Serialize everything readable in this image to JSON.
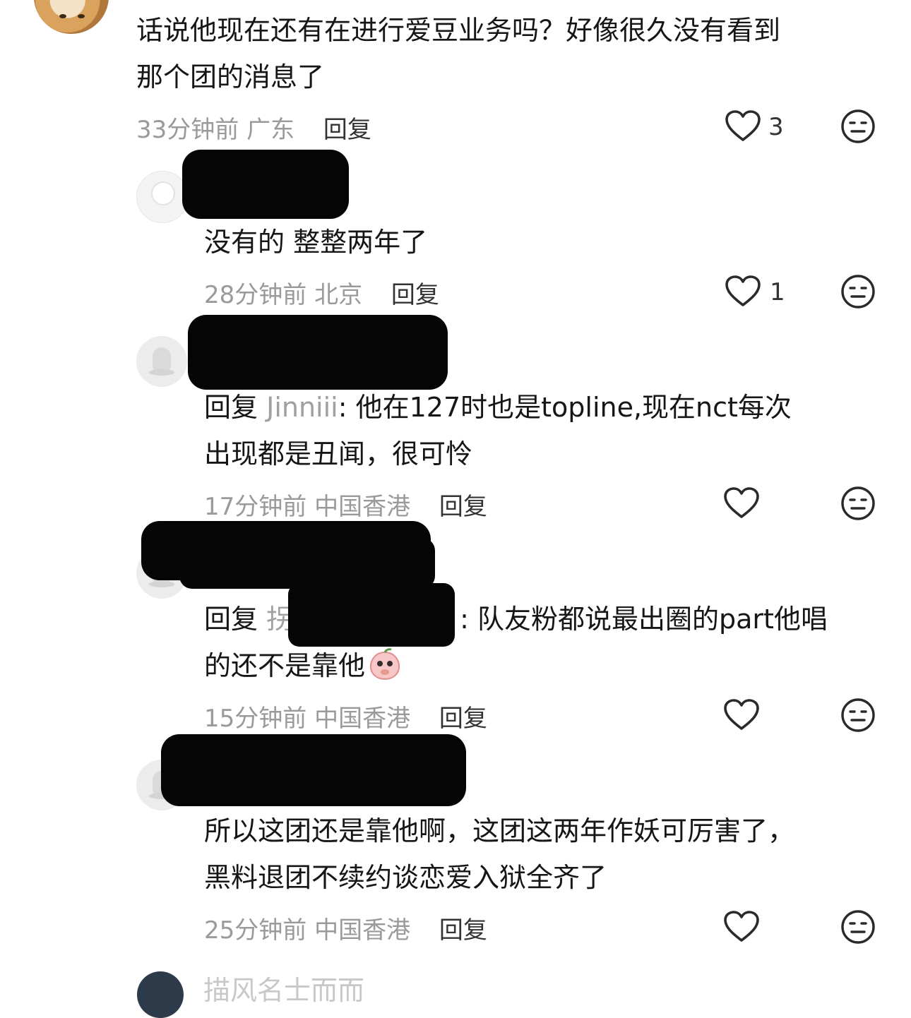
{
  "comments": [
    {
      "text_lines": [
        "话说他现在还有在进行爱豆业务吗？好像很久没有看到",
        "那个团的消息了"
      ],
      "time": "33分钟前",
      "location": "广东",
      "reply_label": "回复",
      "likes": "3"
    },
    {
      "text_lines": [
        "没有的 整整两年了"
      ],
      "time": "28分钟前",
      "location": "北京",
      "reply_label": "回复",
      "likes": "1"
    },
    {
      "reply_prefix": "回复",
      "reply_to": "Jinniii",
      "text_lines": [
        ": 他在127时也是topline,现在nct每次",
        "出现都是丑闻，很可怜"
      ],
      "time": "17分钟前",
      "location": "中国香港",
      "reply_label": "回复"
    },
    {
      "reply_prefix": "回复",
      "reply_to_visible": "拐",
      "text_lines": [
        ": 队友粉都说最出圈的part他唱",
        "的还不是靠他"
      ],
      "time": "15分钟前",
      "location": "中国香港",
      "reply_label": "回复",
      "emoji_icon": "peach-covering-mouth-sticker"
    },
    {
      "text_lines": [
        "所以这团还是靠他啊，这团这两年作妖可厉害了，",
        "黑料退团不续约谈恋爱入狱全齐了"
      ],
      "time": "25分钟前",
      "location": "中国香港",
      "reply_label": "回复"
    }
  ],
  "next_comment_partial": "描风名士而而",
  "icons": {
    "like": "heart-outline-icon",
    "react": "expressionless-face-icon"
  },
  "colors": {
    "text": "#161616",
    "meta": "#9a9a9a",
    "reply_action": "#333333",
    "redaction": "#050505"
  }
}
